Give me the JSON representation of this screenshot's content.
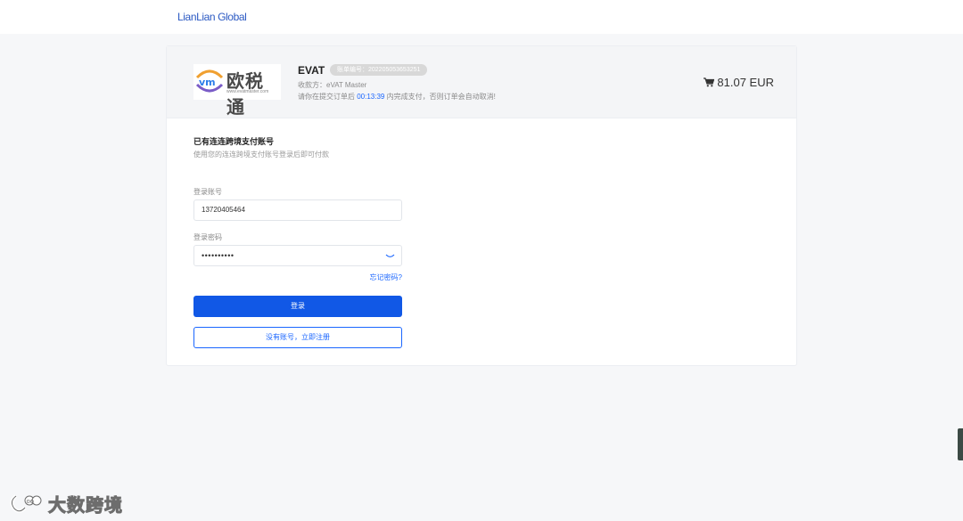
{
  "header": {
    "brand": "LianLian Global"
  },
  "order": {
    "merchant": "EVAT",
    "order_badge": "账单编号：202205053653251",
    "payee": "收款方：eVAT Master",
    "tip_prefix": "请你在提交订单后",
    "countdown": "00:13:39",
    "tip_suffix": "内完成支付，否则订单会自动取消!",
    "amount": "81.07 EUR"
  },
  "logo": {
    "name": "欧税通",
    "url": "www.evatmaster.com"
  },
  "login": {
    "title": "已有连连跨境支付账号",
    "subtitle": "使用您的连连跨境支付账号登录后即可付款",
    "account_label": "登录账号",
    "account_value": "13720405464",
    "password_label": "登录密码",
    "password_value": "••••••••••",
    "forgot": "忘记密码?",
    "login_button": "登录",
    "register_button": "没有账号，立即注册"
  },
  "watermark": {
    "text": "大数跨境"
  },
  "colors": {
    "primary": "#1158e6",
    "link": "#1a66ff",
    "brand": "#2b59c3"
  }
}
